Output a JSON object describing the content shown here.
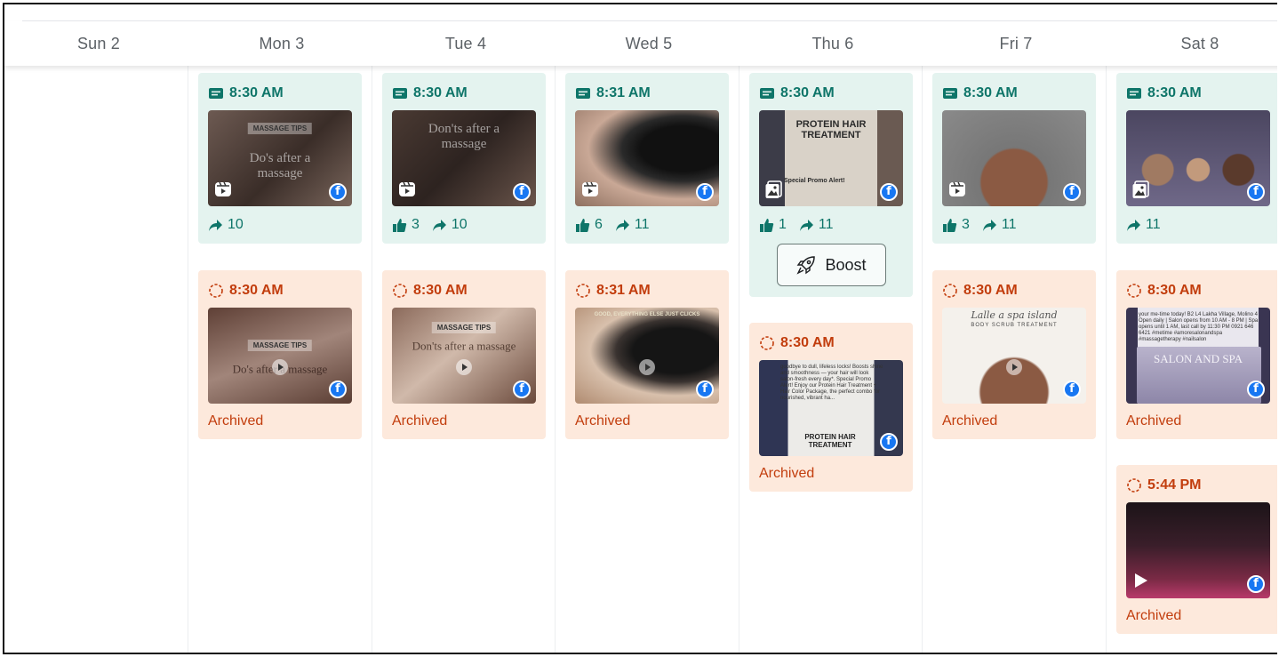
{
  "days": [
    "Sun 2",
    "Mon 3",
    "Tue 4",
    "Wed 5",
    "Thu 6",
    "Fri 7",
    "Sat 8"
  ],
  "common": {
    "archived_label": "Archived",
    "boost_label": "Boost"
  },
  "colors": {
    "published_bg": "#e4f3ef",
    "published_text": "#0e7569",
    "archived_bg": "#fde9dc",
    "archived_text": "#c23d0d",
    "facebook_blue": "#1877f2"
  },
  "columns": {
    "mon": {
      "published": {
        "time": "8:30 AM",
        "type_icon": "reel-icon",
        "thumb_tag": "MASSAGE TIPS",
        "thumb_caption": "Do's after a massage",
        "shares": "10"
      },
      "archived": {
        "time": "8:30 AM",
        "thumb_tag": "MASSAGE TIPS",
        "thumb_caption": "Do's after a massage"
      }
    },
    "tue": {
      "published": {
        "time": "8:30 AM",
        "type_icon": "reel-icon",
        "thumb_caption": "Don'ts after a massage",
        "likes": "3",
        "shares": "10"
      },
      "archived": {
        "time": "8:30 AM",
        "thumb_tag": "MASSAGE TIPS",
        "thumb_caption": "Don'ts after a massage"
      }
    },
    "wed": {
      "published": {
        "time": "8:31 AM",
        "type_icon": "reel-icon",
        "likes": "6",
        "shares": "11"
      },
      "archived": {
        "time": "8:31 AM",
        "thumb_tag": "GOOD, EVERYTHING ELSE JUST CLICKS"
      }
    },
    "thu": {
      "published": {
        "time": "8:30 AM",
        "type_icon": "photo-icon",
        "thumb_title": "PROTEIN HAIR TREATMENT",
        "thumb_promo": "Special Promo Alert!",
        "likes": "1",
        "shares": "11"
      },
      "archived": {
        "time": "8:30 AM",
        "thumb_text": "goodbye to dull, lifeless locks! Boosts shine and smoothness — your hair will look salon-fresh every day*. Special Promo Alert! Enjoy our Protein Hair Treatment + Hair Color Package, the perfect combo for nourished, vibrant ha...",
        "thumb_title": "PROTEIN HAIR TREATMENT"
      }
    },
    "fri": {
      "published": {
        "time": "8:30 AM",
        "type_icon": "reel-icon",
        "likes": "3",
        "shares": "11"
      },
      "archived": {
        "time": "8:30 AM",
        "thumb_script": "Lalle a spa island",
        "thumb_title": "BODY SCRUB TREATMENT"
      }
    },
    "sat": {
      "published": {
        "time": "8:30 AM",
        "type_icon": "photo-icon",
        "shares": "11"
      },
      "archived": {
        "time": "8:30 AM",
        "thumb_text": "your me-time today! B2 L4 Lakha Village, Molino 4 Open daily | Salon opens from 10 AM - 8 PM | Spa opens until 1 AM, last call by 11:30 PM 0921 646 6421 #metime #amoresalonandspa #massagetherapy #nailsalon",
        "thumb_title": "SALON AND SPA"
      },
      "archived2": {
        "time": "5:44 PM"
      }
    }
  }
}
